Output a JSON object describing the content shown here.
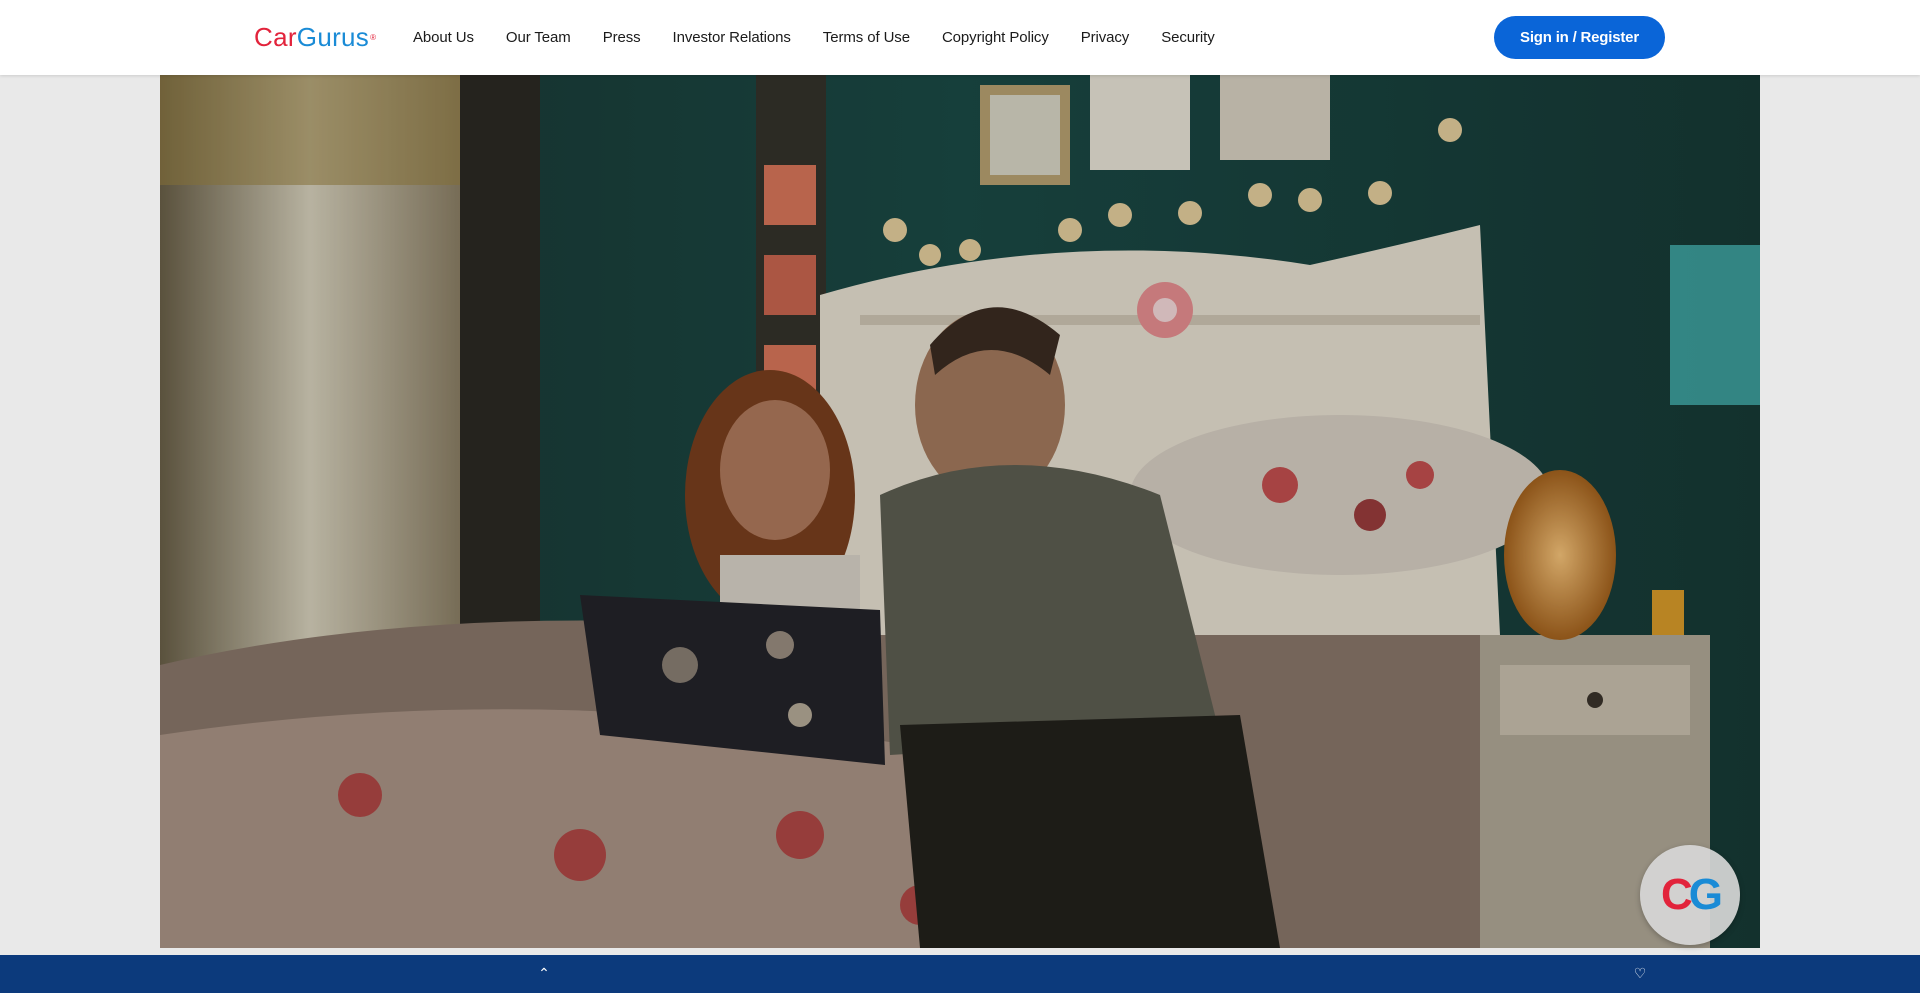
{
  "brand": {
    "logo_part1": "Car",
    "logo_part2": "Gurus",
    "logo_mark": "®",
    "primary_color": "#0a65d8",
    "red": "#e2233b",
    "blue": "#1a8bd6"
  },
  "nav": {
    "items": [
      {
        "label": "About Us"
      },
      {
        "label": "Our Team"
      },
      {
        "label": "Press"
      },
      {
        "label": "Investor Relations"
      },
      {
        "label": "Terms of Use"
      },
      {
        "label": "Copyright Policy"
      },
      {
        "label": "Privacy"
      },
      {
        "label": "Security"
      }
    ]
  },
  "auth": {
    "signin_label": "Sign in / Register"
  },
  "video": {
    "badge_part1": "C",
    "badge_part2": "G"
  },
  "footer": {
    "background": "#0c3a7c",
    "icons": [
      "chevron-up-icon",
      "heart-icon"
    ]
  }
}
